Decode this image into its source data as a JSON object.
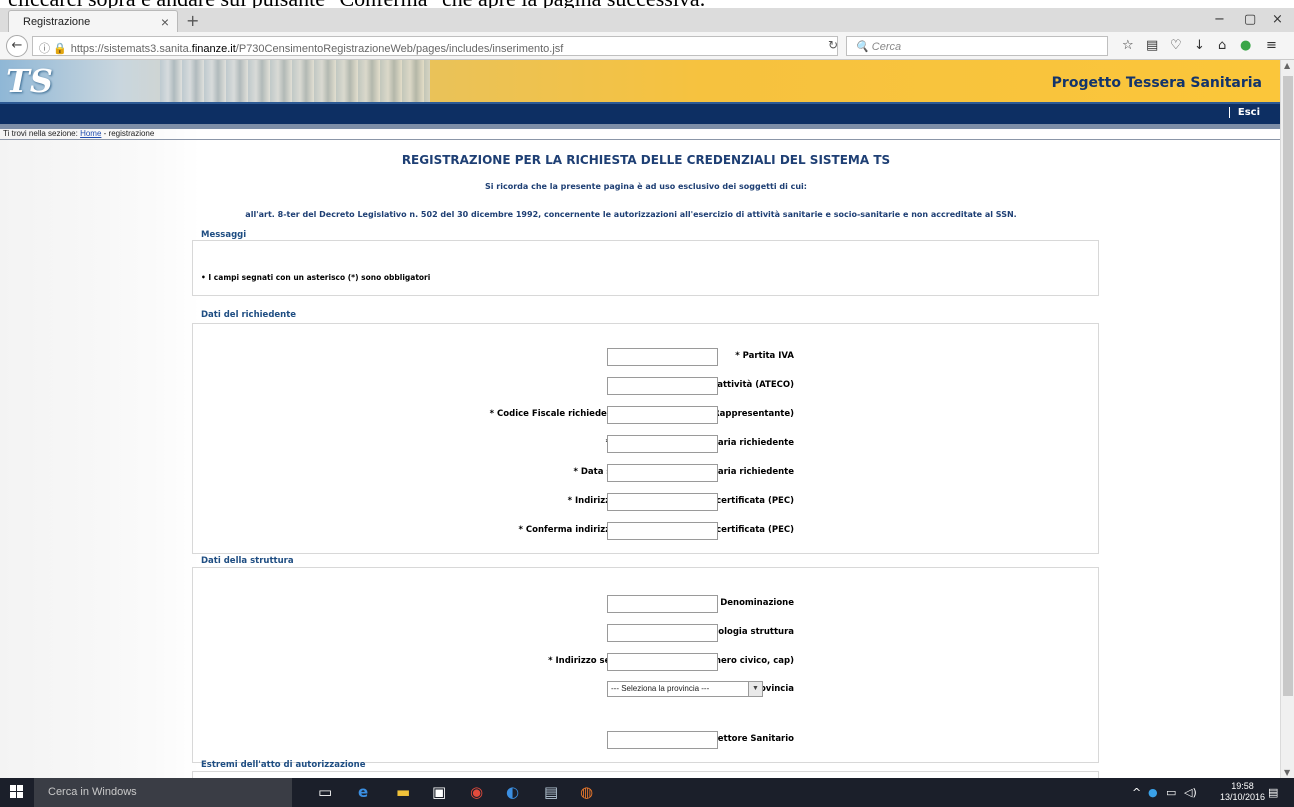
{
  "doc_caption": "cliccarci sopra e andare sul pulsante \"Conferma\" che apre la pagina successiva.",
  "browser": {
    "tab_title": "Registrazione",
    "tab_close": "×",
    "new_tab": "+",
    "url_prefix": "https://sistemats3.sanita.",
    "url_domain": "finanze.it",
    "url_path": "/P730CensimentoRegistrazioneWeb/pages/includes/inserimento.jsf",
    "search_placeholder": "Cerca",
    "win_min": "−",
    "win_max": "▢",
    "win_close": "×"
  },
  "header": {
    "logo": "TS",
    "title": "Progetto Tessera Sanitaria",
    "logout": "Esci"
  },
  "breadcrumb": {
    "prefix": "Ti trovi nella sezione: ",
    "home": "Home",
    "current": " - registrazione"
  },
  "page": {
    "title": "REGISTRAZIONE PER LA RICHIESTA DELLE CREDENZIALI DEL SISTEMA TS",
    "note1": "Si ricorda che la presente pagina è ad uso esclusivo dei soggetti di cui:",
    "note2": "all'art. 8-ter del Decreto Legislativo n. 502 del 30 dicembre 1992, concernente le autorizzazioni all'esercizio di attività sanitarie e socio-sanitarie e non accreditate al SSN."
  },
  "messages": {
    "label": "Messaggi",
    "text": "• I campi segnati con un asterisco (*) sono obbligatori"
  },
  "richiedente": {
    "label": "Dati del richiedente",
    "fields": [
      "* Partita IVA",
      "Codice attività (ATECO)",
      "* Codice Fiscale richiedente (Titolare o Legale Rappresentante)",
      "* Numero Tessera Sanitaria richiedente",
      "* Data scadenza Tessera Sanitaria richiedente",
      "* Indirizzo di Posta elettronica certificata (PEC)",
      "* Conferma indirizzo di Posta elettronica certificata (PEC)"
    ]
  },
  "struttura": {
    "label": "Dati della struttura",
    "fields": [
      "* Denominazione",
      "Tipologia struttura",
      "* Indirizzo sede principale (via, numero civico, cap)",
      "* Provincia",
      "Codice Fiscale Direttore Sanitario"
    ],
    "provincia_selected": "--- Seleziona la provincia ---"
  },
  "autorizzazione": {
    "label": "Estremi dell'atto di autorizzazione"
  },
  "taskbar": {
    "search": "Cerca in Windows",
    "time": "19:58",
    "date": "13/10/2016"
  },
  "colors": {
    "title_blue": "#1e3f74",
    "header_navy": "#0d2f63",
    "banner_gold": "#fbc63a"
  }
}
